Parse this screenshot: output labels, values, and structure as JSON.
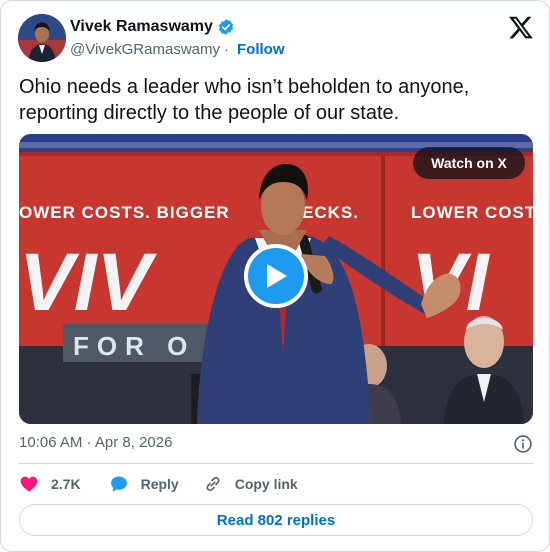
{
  "author": {
    "display_name": "Vivek Ramaswamy",
    "handle": "@VivekGRamaswamy",
    "follow_label": "Follow",
    "separator": "·"
  },
  "tweet": {
    "text": "Ohio needs a leader who isn’t beholden to anyone, reporting directly to the people of our state.",
    "timestamp": "10:06 AM · Apr 8, 2026"
  },
  "media": {
    "type": "video",
    "watch_label": "Watch on X",
    "banner_left": "OWER COSTS. BIGGER",
    "banner_left_end": "ECKS.",
    "banner_right": "LOWER COST",
    "logo_left": "VIV",
    "logo_right": "VI",
    "sign_text": "FOR O"
  },
  "actions": {
    "like_count": "2.7K",
    "reply_label": "Reply",
    "copy_label": "Copy link"
  },
  "footer": {
    "read_replies_label": "Read 802 replies"
  },
  "colors": {
    "accent": "#1d9bf0",
    "link": "#006fd6",
    "like": "#f91880",
    "backdrop_red": "#c8372f"
  },
  "icons": {
    "verified": "verified-badge-icon",
    "x_logo": "x-logo-icon",
    "play": "play-icon",
    "info": "info-icon",
    "like": "heart-icon",
    "reply": "reply-bubble-icon",
    "copy": "link-icon"
  }
}
